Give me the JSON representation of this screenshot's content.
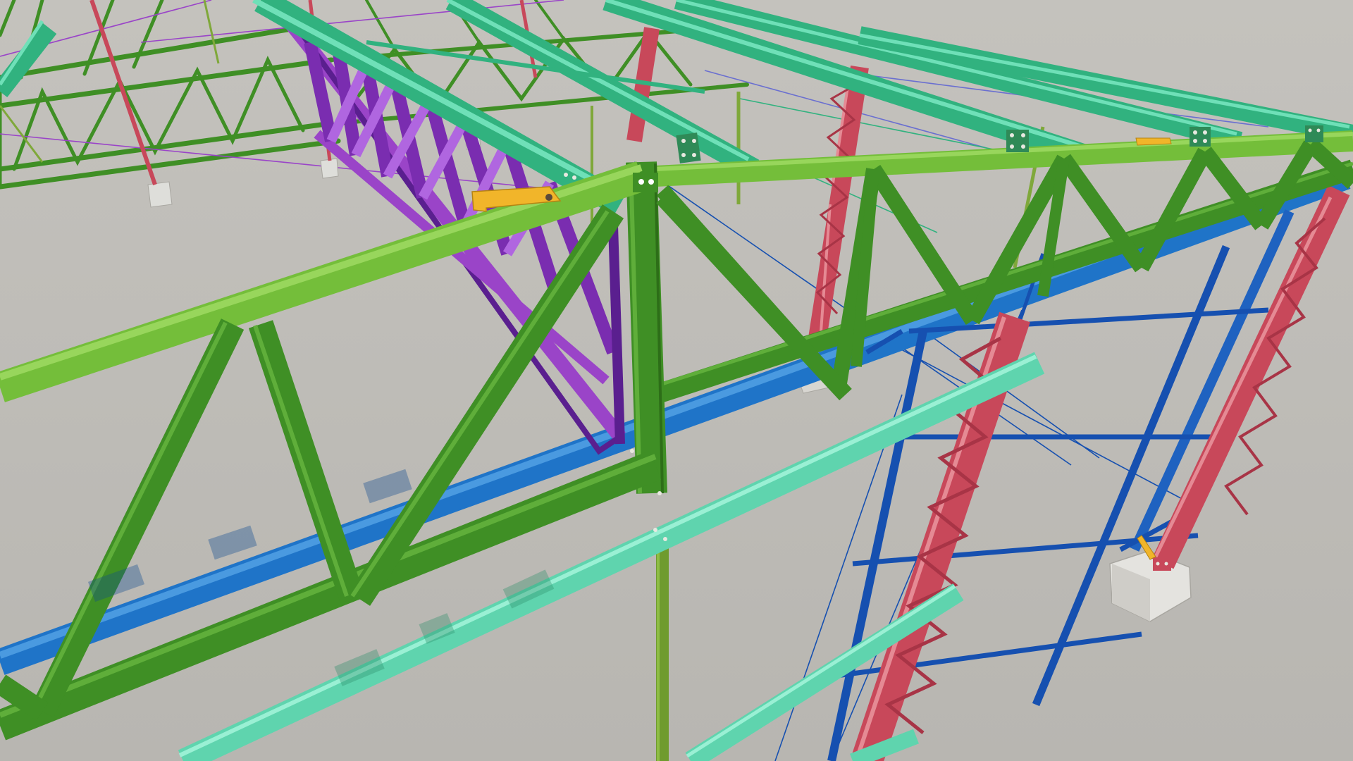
{
  "scene": {
    "kind": "3d-steel-structure-viewport",
    "colors": {
      "background": "#bdbbb6",
      "truss_green": "#3f8f25",
      "top_chord_green": "#74be3a",
      "purlin_teal": "#31b27f",
      "purlin_aqua": "#5fd4ae",
      "purple_truss": "#9a44c8",
      "purple_dark": "#5a1f8f",
      "blue_girt": "#1f74c8",
      "blue_frame": "#1650b0",
      "red_column": "#c8485a",
      "bracket_yellow": "#f1b52a",
      "footing_grey": "#dededa",
      "olive_post": "#7fa83a",
      "bolt": "#e8e8e0"
    },
    "icons": [
      "bolt-plate",
      "footing-block",
      "yellow-bracket"
    ]
  }
}
